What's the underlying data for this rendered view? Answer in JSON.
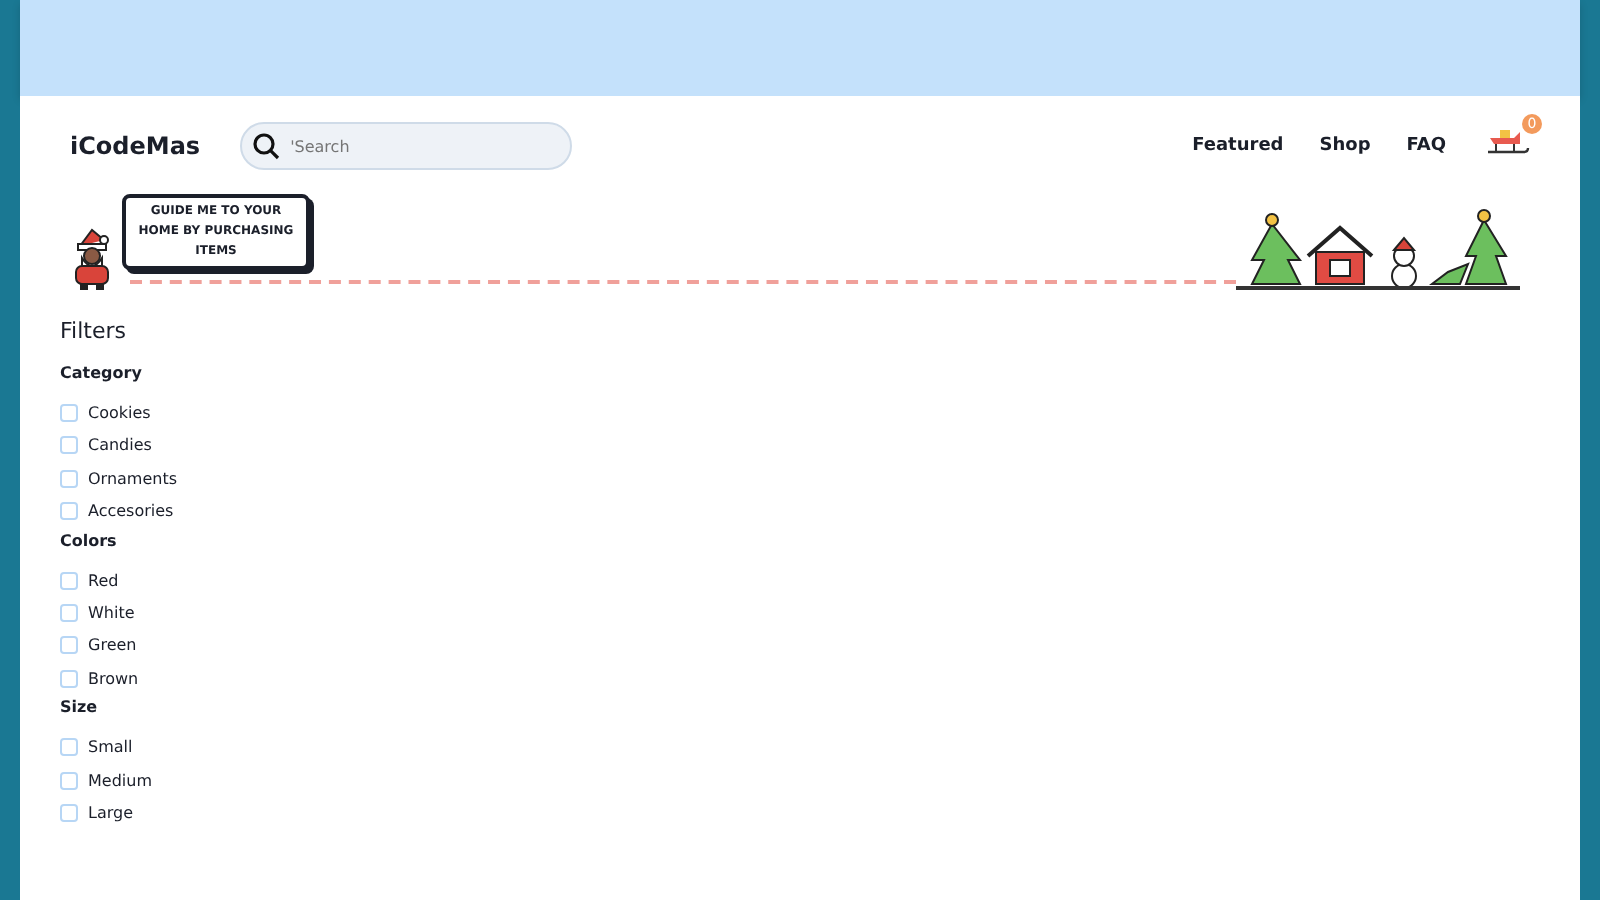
{
  "brand": "iCodeMas",
  "search": {
    "placeholder": "'Search"
  },
  "nav": [
    "Featured",
    "Shop",
    "FAQ"
  ],
  "cart": {
    "count": "0"
  },
  "banner": {
    "bubble": "GUIDE ME TO YOUR HOME BY PURCHASING ITEMS"
  },
  "filters": {
    "title": "Filters",
    "groups": [
      {
        "title": "Category",
        "options": [
          {
            "label": "Cookies",
            "checked": false
          },
          {
            "label": "Candies",
            "checked": false
          },
          {
            "label": "Ornaments",
            "checked": false
          },
          {
            "label": "Accesories",
            "checked": false
          }
        ]
      },
      {
        "title": "Colors",
        "options": [
          {
            "label": "Red",
            "checked": false
          },
          {
            "label": "White",
            "checked": false
          },
          {
            "label": "Green",
            "checked": false
          },
          {
            "label": "Brown",
            "checked": false
          }
        ]
      },
      {
        "title": "Size",
        "options": [
          {
            "label": "Small",
            "checked": false
          },
          {
            "label": "Medium",
            "checked": false
          },
          {
            "label": "Large",
            "checked": false
          }
        ]
      }
    ]
  }
}
